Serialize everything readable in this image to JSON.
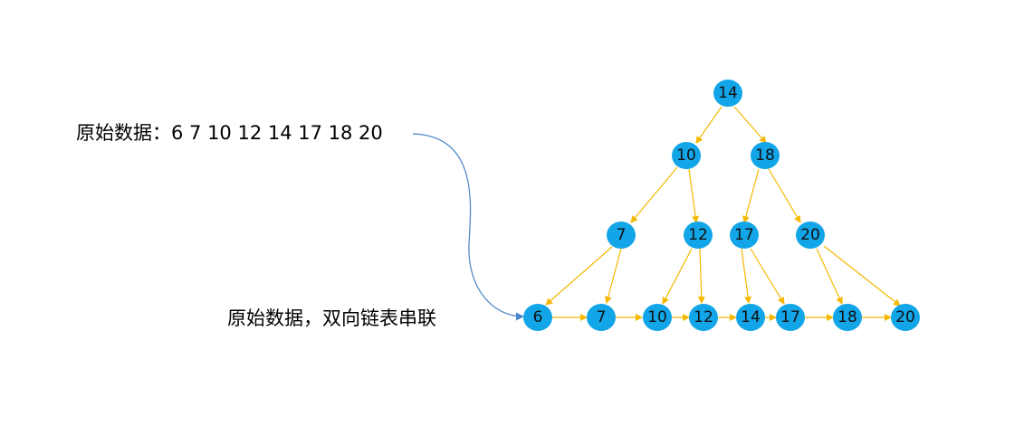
{
  "labels": {
    "raw_data_prefix": "原始数据：",
    "raw_data_values": "6  7  10  12  14  17  18  20",
    "linked_list_label": "原始数据，双向链表串联"
  },
  "colors": {
    "node_fill": "#12a5e8",
    "edge": "#f5b800",
    "curve": "#4a86c8",
    "text": "#111111"
  },
  "nodes": {
    "root": "14",
    "l1_left": "10",
    "l1_right": "18",
    "l2_a": "7",
    "l2_b": "12",
    "l2_c": "17",
    "l2_d": "20",
    "base_1": "6",
    "base_2": "7",
    "base_3": "10",
    "base_4": "12",
    "base_5": "14",
    "base_6": "17",
    "base_7": "18",
    "base_8": "20"
  }
}
